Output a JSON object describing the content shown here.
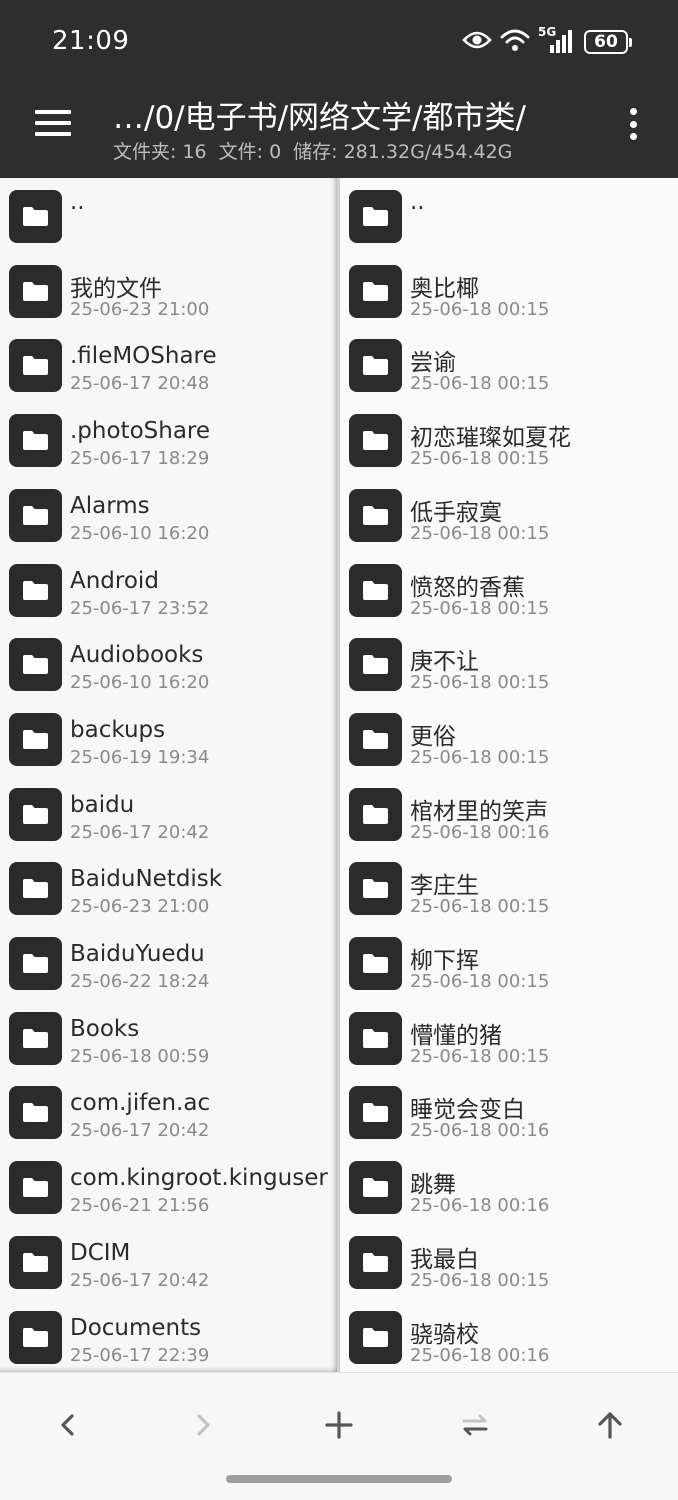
{
  "status_bar": {
    "time": "21:09",
    "network_label": "5G",
    "battery_level": "60",
    "icons": [
      "eye-icon",
      "wifi-icon",
      "signal-icon",
      "battery-icon"
    ]
  },
  "header": {
    "path": "…/0/电子书/网络文学/都市类/",
    "folders_label": "文件夹: 16",
    "files_label": "文件: 0",
    "storage_label": "储存: 281.32G/454.42G",
    "menu_icon": "menu-icon",
    "more_icon": "more-vert-icon"
  },
  "left_pane": {
    "items": [
      {
        "name": "..",
        "date": ""
      },
      {
        "name": " 我的文件",
        "date": "25-06-23 21:00"
      },
      {
        "name": ".fileMOShare",
        "date": "25-06-17 20:48"
      },
      {
        "name": ".photoShare",
        "date": "25-06-17 18:29"
      },
      {
        "name": "Alarms",
        "date": "25-06-10 16:20"
      },
      {
        "name": "Android",
        "date": "25-06-17 23:52"
      },
      {
        "name": "Audiobooks",
        "date": "25-06-10 16:20"
      },
      {
        "name": "backups",
        "date": "25-06-19 19:34"
      },
      {
        "name": "baidu",
        "date": "25-06-17 20:42"
      },
      {
        "name": "BaiduNetdisk",
        "date": "25-06-23 21:00"
      },
      {
        "name": "BaiduYuedu",
        "date": "25-06-22 18:24"
      },
      {
        "name": "Books",
        "date": "25-06-18 00:59"
      },
      {
        "name": "com.jifen.ac",
        "date": "25-06-17 20:42"
      },
      {
        "name": "com.kingroot.kinguser",
        "date": "25-06-21 21:56"
      },
      {
        "name": "DCIM",
        "date": "25-06-17 20:42"
      },
      {
        "name": "Documents",
        "date": "25-06-17 22:39"
      }
    ]
  },
  "right_pane": {
    "items": [
      {
        "name": "..",
        "date": ""
      },
      {
        "name": "奥比椰",
        "date": "25-06-18 00:15"
      },
      {
        "name": "尝谕",
        "date": "25-06-18 00:15"
      },
      {
        "name": "初恋璀璨如夏花",
        "date": "25-06-18 00:15"
      },
      {
        "name": "低手寂寞",
        "date": "25-06-18 00:15"
      },
      {
        "name": "愤怒的香蕉",
        "date": "25-06-18 00:15"
      },
      {
        "name": "庚不让",
        "date": "25-06-18 00:15"
      },
      {
        "name": "更俗",
        "date": "25-06-18 00:15"
      },
      {
        "name": "棺材里的笑声",
        "date": "25-06-18 00:16"
      },
      {
        "name": "李庄生",
        "date": "25-06-18 00:15"
      },
      {
        "name": "柳下挥",
        "date": "25-06-18 00:15"
      },
      {
        "name": "懵懂的猪",
        "date": "25-06-18 00:15"
      },
      {
        "name": "睡觉会变白",
        "date": "25-06-18 00:16"
      },
      {
        "name": "跳舞",
        "date": "25-06-18 00:16"
      },
      {
        "name": "我最白",
        "date": "25-06-18 00:15"
      },
      {
        "name": "骁骑校",
        "date": "25-06-18 00:16"
      }
    ]
  },
  "bottom_bar": {
    "buttons": [
      "back-arrow-icon",
      "forward-arrow-icon",
      "add-icon",
      "swap-icon",
      "up-arrow-icon"
    ]
  },
  "colors": {
    "header_bg": "#2e2e2e",
    "folder_tile": "#2b2b2b",
    "text_primary": "#2b2b2b",
    "text_secondary": "#8a8a8a",
    "disabled": "#c4c4c4"
  }
}
